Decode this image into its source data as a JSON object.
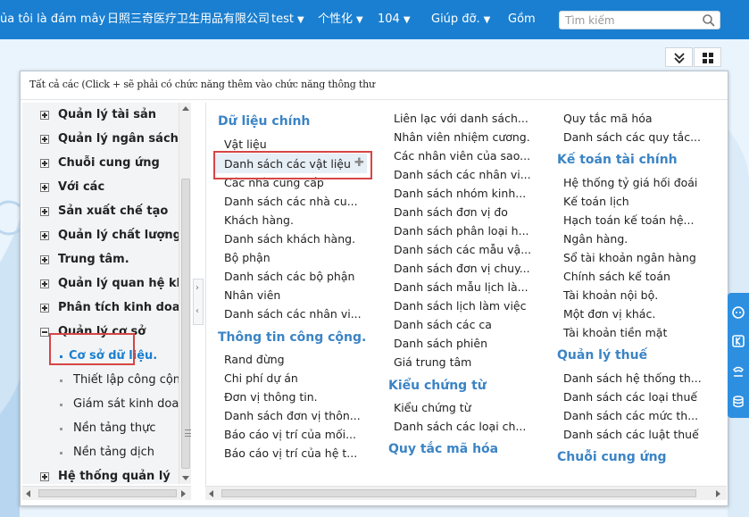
{
  "topnav": {
    "items": [
      {
        "label": "ủa tôi là đám mây",
        "caret": false
      },
      {
        "label": "日照三奇医疗卫生用品有限公司",
        "caret": false
      },
      {
        "label": "test",
        "caret": true
      },
      {
        "label": "个性化",
        "caret": true
      },
      {
        "label": "104",
        "caret": true
      },
      {
        "label": "Giúp đỡ.",
        "caret": true
      },
      {
        "label": "Gồm",
        "caret": false
      }
    ],
    "search_placeholder": "Tìm kiếm"
  },
  "hint": "Tất cả các (Click + sẽ phải có chức năng thêm vào chức năng thông thư",
  "tree": [
    {
      "label": "Quản lý tài sản",
      "expanded": false
    },
    {
      "label": "Quản lý ngân sách",
      "expanded": false
    },
    {
      "label": "Chuỗi cung ứng",
      "expanded": false
    },
    {
      "label": "Với các",
      "expanded": false
    },
    {
      "label": "Sản xuất chế tạo",
      "expanded": false
    },
    {
      "label": "Quản lý chất lượng",
      "expanded": false
    },
    {
      "label": "Trung tâm.",
      "expanded": false
    },
    {
      "label": "Quản lý quan hệ khách",
      "expanded": false
    },
    {
      "label": "Phân tích kinh doanh",
      "expanded": false
    },
    {
      "label": "Quản lý cơ sở",
      "expanded": true
    },
    {
      "label": "Cơ sở dữ liệu.",
      "child": true,
      "active": true
    },
    {
      "label": "Thiết lập công cộng.",
      "child": true
    },
    {
      "label": "Giám sát kinh doanh",
      "child": true
    },
    {
      "label": "Nền tảng thực",
      "child": true
    },
    {
      "label": "Nền tảng dịch",
      "child": true
    },
    {
      "label": "Hệ thống quản lý",
      "expanded": false
    }
  ],
  "col1": {
    "sections": [
      {
        "title": "Dữ liệu chính",
        "items": [
          "Vật liệu",
          "Danh sách các vật liệu",
          "Các nhà cung cấp",
          "Danh sách các nhà cu...",
          "Khách hàng.",
          "Danh sách khách hàng.",
          "Bộ phận",
          "Danh sách các bộ phận",
          "Nhân viên",
          "Danh sách các nhân vi..."
        ]
      },
      {
        "title": "Thông tin công cộng.",
        "items": [
          "Rand đừng",
          "Chi phí dự án",
          "Đơn vị thông tin.",
          "Danh sách đơn vị thôn...",
          "Báo cáo vị trí của mối...",
          "Báo cáo vị trí của hệ t..."
        ]
      }
    ]
  },
  "col2": {
    "items_top": [
      "Liên lạc với danh sách...",
      "Nhân viên nhiệm cương.",
      "Các nhân viên của sao...",
      "Danh sách các nhân vi...",
      "Danh sách nhóm kinh...",
      "Danh sách đơn vị đo",
      "Danh sách phân loại h...",
      "Danh sách các mẫu vậ...",
      "Danh sách đơn vị chuy...",
      "Danh sách mẫu lịch là...",
      "Danh sách lịch làm việc",
      "Danh sách các ca",
      "Danh sách phiên",
      "Giá trung tâm"
    ],
    "sections": [
      {
        "title": "Kiểu chứng từ",
        "items": [
          "Kiểu chứng từ",
          "Danh sách các loại ch..."
        ]
      },
      {
        "title": "Quy tắc mã hóa",
        "items": []
      }
    ]
  },
  "col3": {
    "items_top": [
      "Quy tắc mã hóa",
      "Danh sách các quy tắc..."
    ],
    "sections": [
      {
        "title": "Kế toán tài chính",
        "items": [
          "Hệ thống tỷ giá hối đoái",
          "Kế toán lịch",
          "Hạch toán kế toán hệ...",
          "Ngân hàng.",
          "Sổ tài khoản ngân hàng",
          "Chính sách kế toán",
          "Tài khoản nội bộ.",
          "Một đơn vị khác.",
          "Tài khoản tiền mặt"
        ]
      },
      {
        "title": "Quản lý thuế",
        "items": [
          "Danh sách hệ thống th...",
          "Danh sách các loại thuế",
          "Danh sách các mức th...",
          "Danh sách các luật thuế"
        ]
      },
      {
        "title": "Chuỗi cung ứng",
        "items": []
      }
    ]
  },
  "colors": {
    "topbar": "#1a7fd0",
    "heading": "#3b84c5",
    "highlight": "#d64545"
  }
}
